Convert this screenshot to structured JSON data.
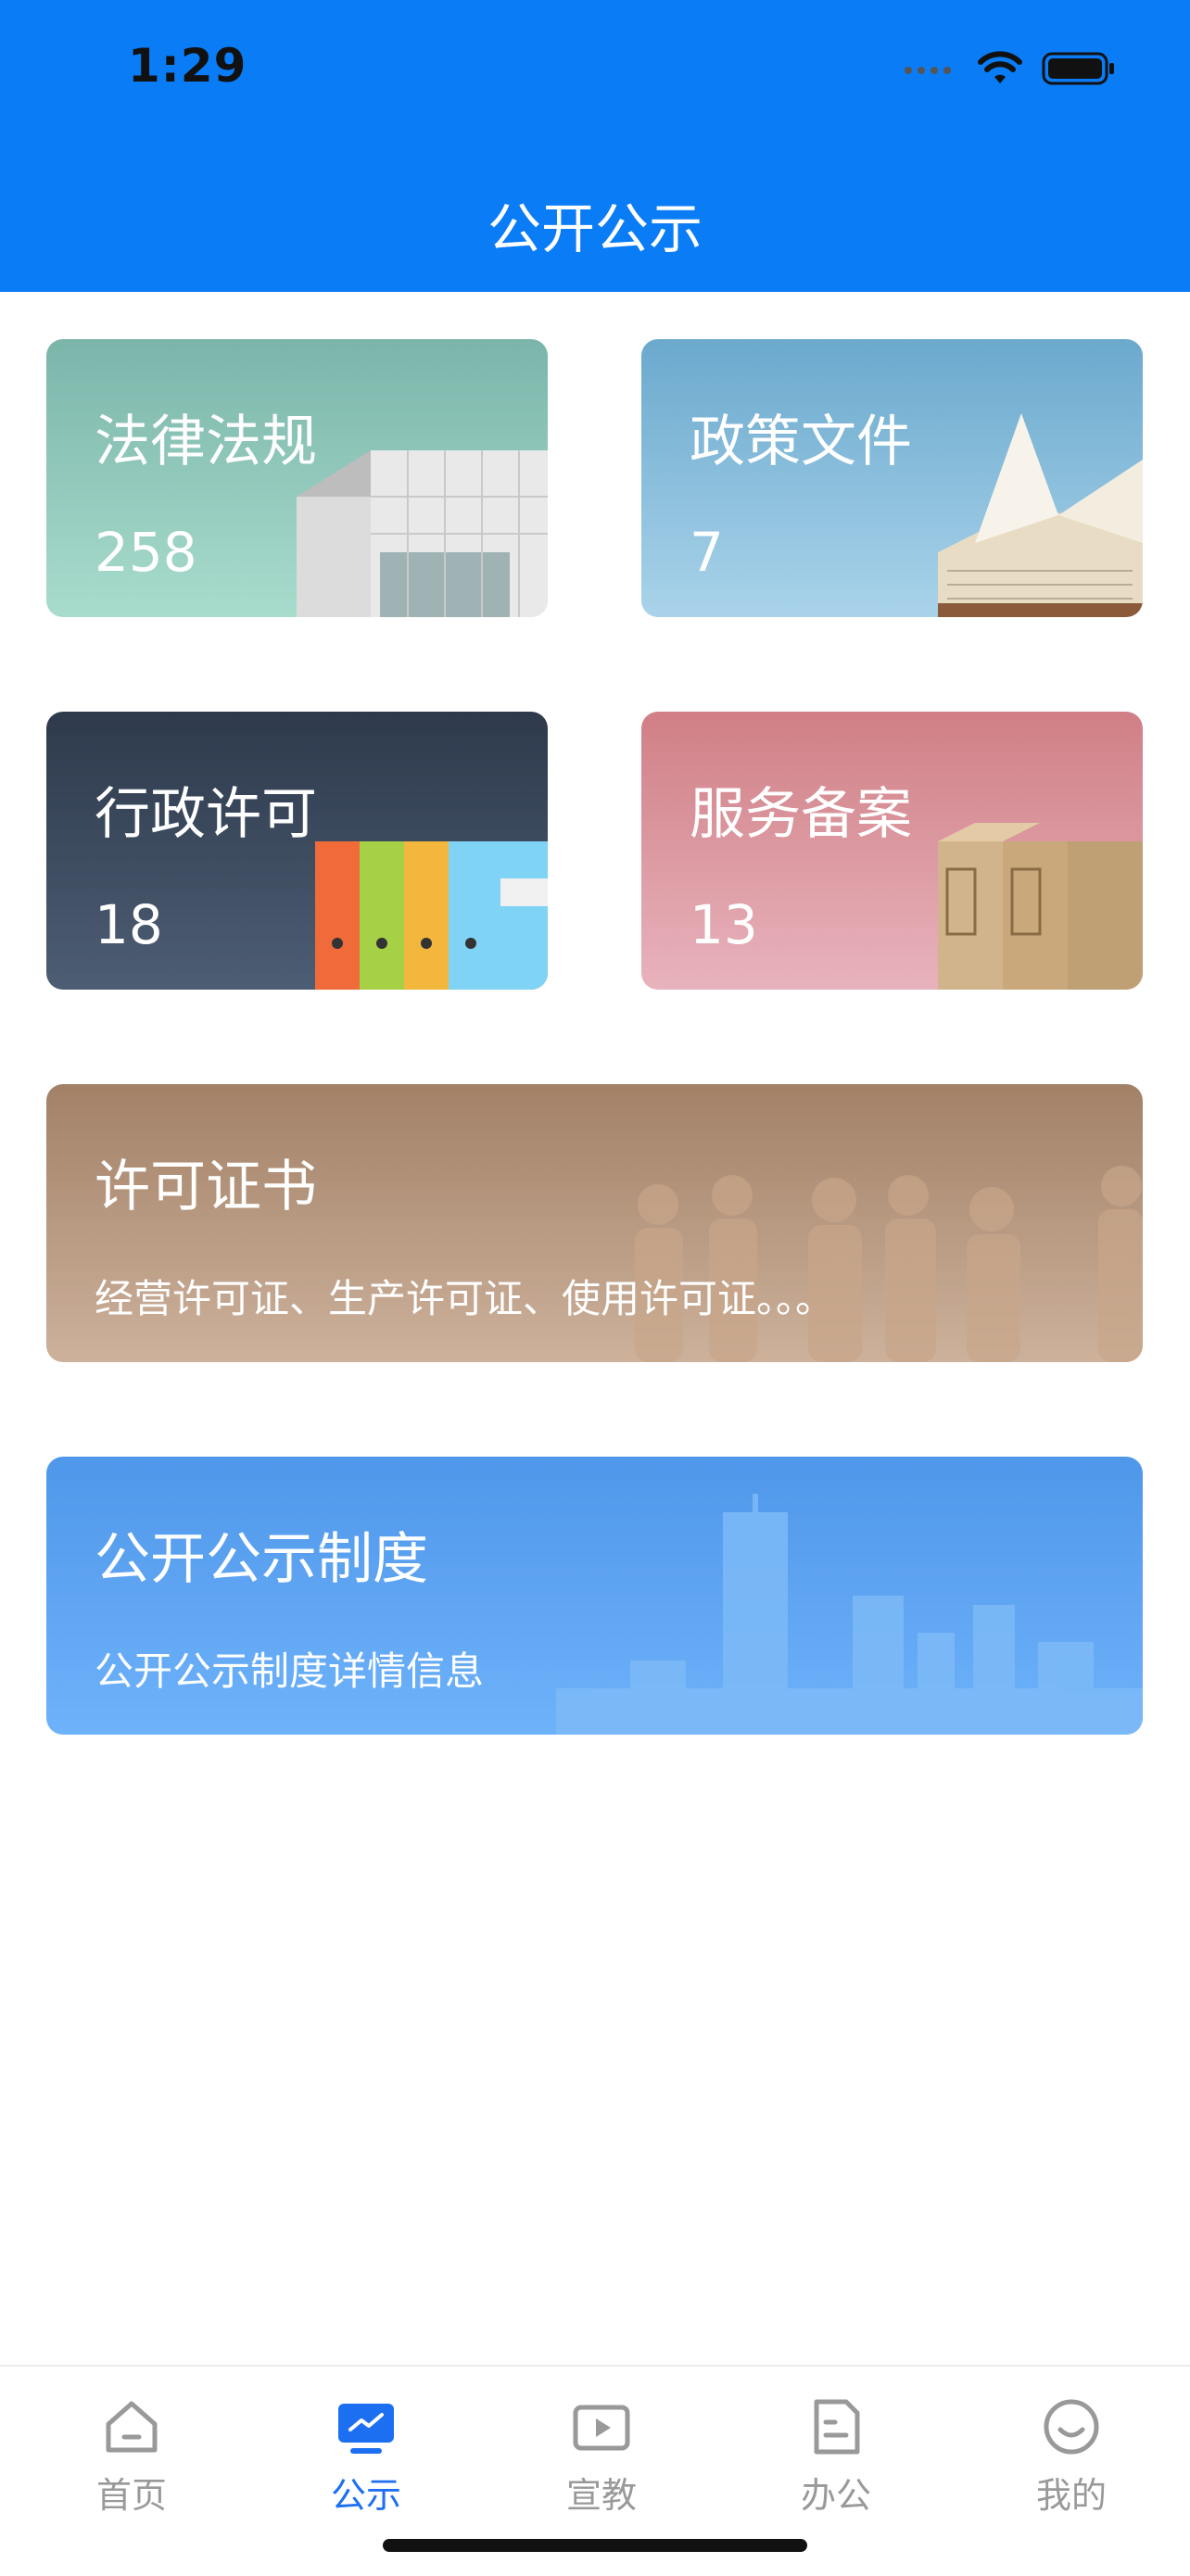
{
  "status_bar": {
    "time": "1:29"
  },
  "header": {
    "title": "公开公示"
  },
  "cards": [
    {
      "title": "法律法规",
      "count": "258"
    },
    {
      "title": "政策文件",
      "count": "7"
    },
    {
      "title": "行政许可",
      "count": "18"
    },
    {
      "title": "服务备案",
      "count": "13"
    }
  ],
  "banners": [
    {
      "title": "许可证书",
      "description": "经营许可证、生产许可证、使用许可证。。。"
    },
    {
      "title": "公开公示制度",
      "description": "公开公示制度详情信息"
    }
  ],
  "tabbar": {
    "items": [
      {
        "label": "首页",
        "icon": "home-icon"
      },
      {
        "label": "公示",
        "icon": "monitor-chart-icon"
      },
      {
        "label": "宣教",
        "icon": "play-video-icon"
      },
      {
        "label": "办公",
        "icon": "document-icon"
      },
      {
        "label": "我的",
        "icon": "smile-icon"
      }
    ],
    "active_index": 1,
    "active_color": "#1d6ff2"
  },
  "colors": {
    "header": "#0a7cf5",
    "tab_inactive": "#999999"
  }
}
